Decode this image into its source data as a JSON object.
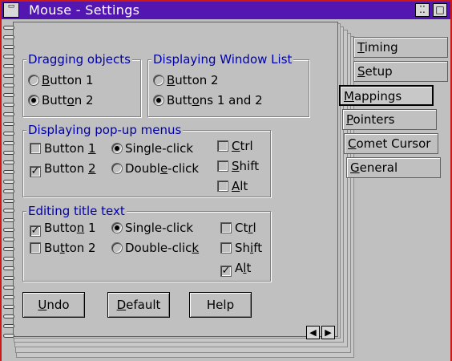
{
  "window": {
    "title": "Mouse - Settings",
    "restore_glyph": "⁚⁚",
    "maximize_glyph": "□",
    "sysmenu_glyph": "▭"
  },
  "groups": {
    "dragging": {
      "title": "Dragging objects",
      "options": [
        {
          "label_u": "B",
          "label_rest": "utton 1",
          "selected": false
        },
        {
          "label_u": "",
          "label_rest": "Button 2",
          "selected": true
        }
      ]
    },
    "window_list": {
      "title": "Displaying Window List",
      "options": [
        {
          "label_pre": "",
          "label_u": "B",
          "label_rest": "utton 2",
          "selected": false
        },
        {
          "label_pre": "Butt",
          "label_u": "o",
          "label_rest": "ns 1 and 2",
          "selected": true
        }
      ]
    },
    "popup": {
      "title": "Displaying pop-up menus",
      "button1": {
        "pre": "Button ",
        "u": "1",
        "checked": false
      },
      "button2": {
        "pre": "Button ",
        "u": "2",
        "checked": true
      },
      "single": {
        "label": "Single-click",
        "selected": true
      },
      "double": {
        "pre": "Doubl",
        "u": "e",
        "post": "-click",
        "selected": false
      },
      "ctrl": {
        "u": "C",
        "rest": "trl",
        "checked": false
      },
      "shift": {
        "u": "S",
        "rest": "hift",
        "checked": false
      },
      "alt": {
        "u": "A",
        "rest": "lt",
        "checked": false
      }
    },
    "title_text": {
      "title": "Editing title text",
      "button1": {
        "pre": "Butto",
        "u": "n",
        "post": " 1",
        "checked": true
      },
      "button2": {
        "pre": "Bu",
        "u": "t",
        "post": "ton 2",
        "checked": false
      },
      "single": {
        "label": "Single-click",
        "selected": true
      },
      "double": {
        "pre": "Double-clic",
        "u": "k",
        "post": "",
        "selected": false
      },
      "ctrl": {
        "pre": "Ct",
        "u": "r",
        "post": "l",
        "checked": false
      },
      "shift": {
        "pre": "Sh",
        "u": "i",
        "post": "ft",
        "checked": false
      },
      "alt": {
        "pre": "A",
        "u": "l",
        "post": "t",
        "checked": true
      }
    }
  },
  "buttons": {
    "undo": {
      "u": "U",
      "rest": "ndo"
    },
    "default": {
      "u": "D",
      "rest": "efault"
    },
    "help": "Help"
  },
  "tabs": [
    {
      "u": "T",
      "rest": "iming"
    },
    {
      "u": "S",
      "rest": "etup"
    },
    {
      "u": "M",
      "rest": "appings",
      "selected": true
    },
    {
      "u": "P",
      "rest": "ointers"
    },
    {
      "u": "C",
      "rest": "omet Cursor"
    },
    {
      "u": "G",
      "rest": "eneral"
    }
  ],
  "nav": {
    "prev": "◀",
    "next": "▶"
  },
  "check_glyph": "✓"
}
